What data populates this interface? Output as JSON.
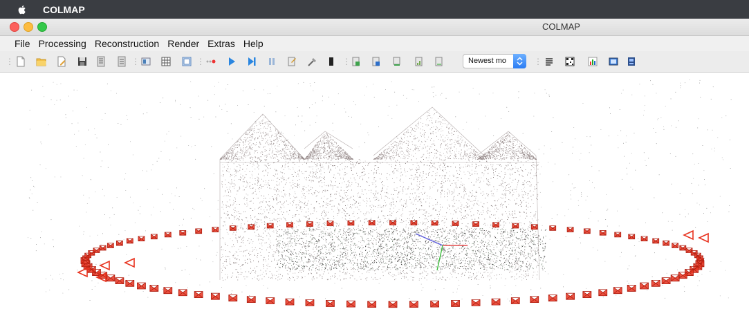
{
  "system_menubar": {
    "app_name": "COLMAP"
  },
  "window": {
    "title": "COLMAP"
  },
  "menu": {
    "items": [
      "File",
      "Processing",
      "Reconstruction",
      "Render",
      "Extras",
      "Help"
    ]
  },
  "toolbar": {
    "model_select": {
      "value": "Newest mo"
    },
    "icons": [
      "new-project-icon",
      "open-project-icon",
      "edit-project-icon",
      "save-project-icon",
      "import-model-icon",
      "export-model-icon",
      "feature-extraction-icon",
      "feature-matching-icon",
      "database-management-icon",
      "automatic-reconstruction-icon",
      "start-reconstruction-icon",
      "step-reconstruction-icon",
      "pause-reconstruction-icon",
      "reconstruction-options-icon",
      "bundle-adjustment-icon",
      "render-toggle-icon",
      "undistort-icon",
      "dense-reconstruction-icon",
      "export-dense-icon",
      "model-stats-icon",
      "log-icon",
      "match-matrix-icon",
      "show-stats-icon",
      "grab-image-icon",
      "grab-movie-icon"
    ]
  },
  "colors": {
    "camera": "#e8321e",
    "menubar": "#3a3d42"
  }
}
